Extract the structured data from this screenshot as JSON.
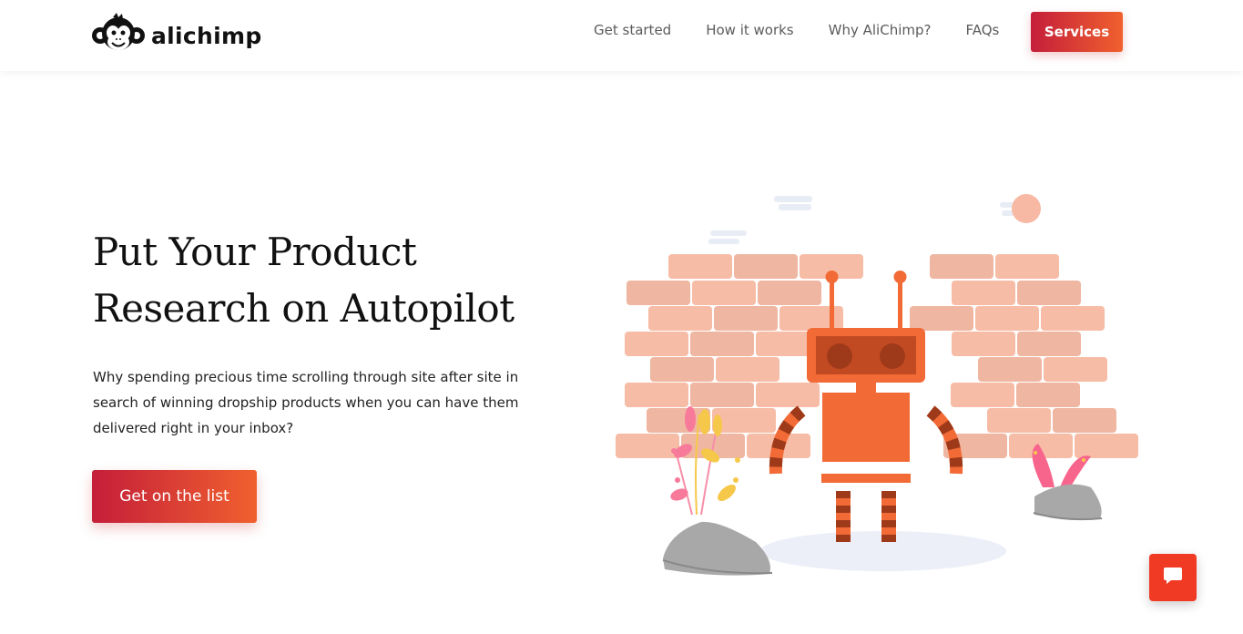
{
  "brand": {
    "name": "alichimp",
    "logo_icon": "monkey-icon"
  },
  "nav": {
    "links": [
      "Get started",
      "How it works",
      "Why AliChimp?",
      "FAQs"
    ],
    "cta": "Services"
  },
  "hero": {
    "title_line1": "Put Your Product",
    "title_line2": "Research on Autopilot",
    "text": "Why spending precious time scrolling through site after site in search of winning dropship products when you can have them delivered right in your inbox?",
    "cta": "Get on the list"
  },
  "chat": {
    "icon": "chat-bubble-icon"
  },
  "colors": {
    "accent_start": "#c41e3a",
    "accent_end": "#f0602e",
    "robot": "#f26a35",
    "brick": "#f7b9a3"
  }
}
